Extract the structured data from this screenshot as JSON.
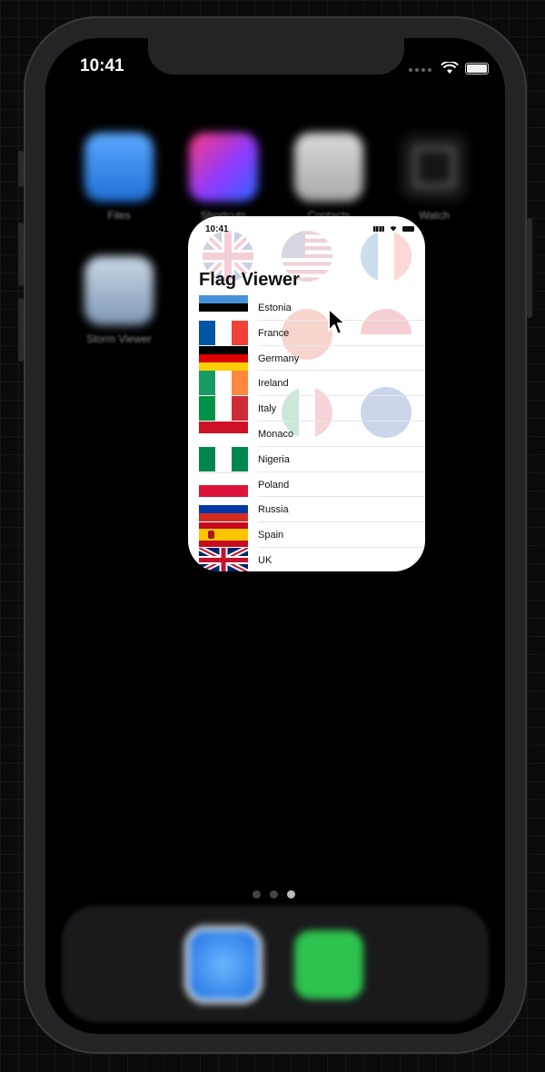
{
  "status_bar": {
    "time": "10:41"
  },
  "home": {
    "apps": [
      {
        "label": "Files",
        "icon": "files-icon",
        "color": "#2f7de1"
      },
      {
        "label": "Shortcuts",
        "icon": "shortcuts-icon",
        "color": "#b03ad8"
      },
      {
        "label": "Contacts",
        "icon": "contacts-icon",
        "color": "#c8c8c8"
      },
      {
        "label": "Watch",
        "icon": "watch-icon",
        "color": "#1c1c1e"
      },
      {
        "label": "Storm Viewer",
        "icon": "storm-icon",
        "color": "#9cb3c9"
      }
    ],
    "page_count": 3,
    "active_page": 2,
    "dock": [
      {
        "name": "Safari",
        "icon": "safari-icon",
        "color": "#2f8ff0"
      },
      {
        "name": "Messages",
        "icon": "messages-icon",
        "color": "#34c759"
      }
    ]
  },
  "app": {
    "status_time": "10:41",
    "title": "Flag Viewer",
    "background_flags": [
      "uk-flag-icon",
      "us-flag-icon",
      "france-flag-icon",
      "china-flag-icon",
      "monaco-flag-icon",
      "italy-flag-icon",
      "eu-flag-icon"
    ],
    "flags": [
      {
        "name": "Estonia"
      },
      {
        "name": "France"
      },
      {
        "name": "Germany"
      },
      {
        "name": "Ireland"
      },
      {
        "name": "Italy"
      },
      {
        "name": "Monaco"
      },
      {
        "name": "Nigeria"
      },
      {
        "name": "Poland"
      },
      {
        "name": "Russia"
      },
      {
        "name": "Spain"
      },
      {
        "name": "UK"
      }
    ]
  }
}
